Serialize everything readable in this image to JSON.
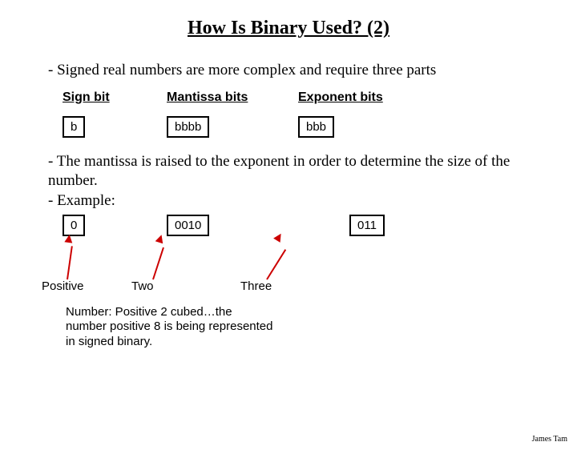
{
  "title": "How Is Binary Used? (2)",
  "bullets": {
    "intro": "- Signed real numbers are more complex and require three parts",
    "mantissa_raised": "- The mantissa is raised to the exponent in order to determine the size of the number.",
    "example": "- Example:"
  },
  "headers": {
    "sign": "Sign bit",
    "mantissa": "Mantissa bits",
    "exponent": "Exponent bits"
  },
  "schema": {
    "sign": "b",
    "mantissa": "bbbb",
    "exponent": "bbb"
  },
  "example_values": {
    "sign": "0",
    "mantissa": "0010",
    "exponent": "011"
  },
  "labels": {
    "positive": "Positive",
    "two": "Two",
    "three": "Three"
  },
  "conclusion": "Number: Positive 2 cubed…the number positive 8 is being represented in signed binary.",
  "footer": "James Tam"
}
